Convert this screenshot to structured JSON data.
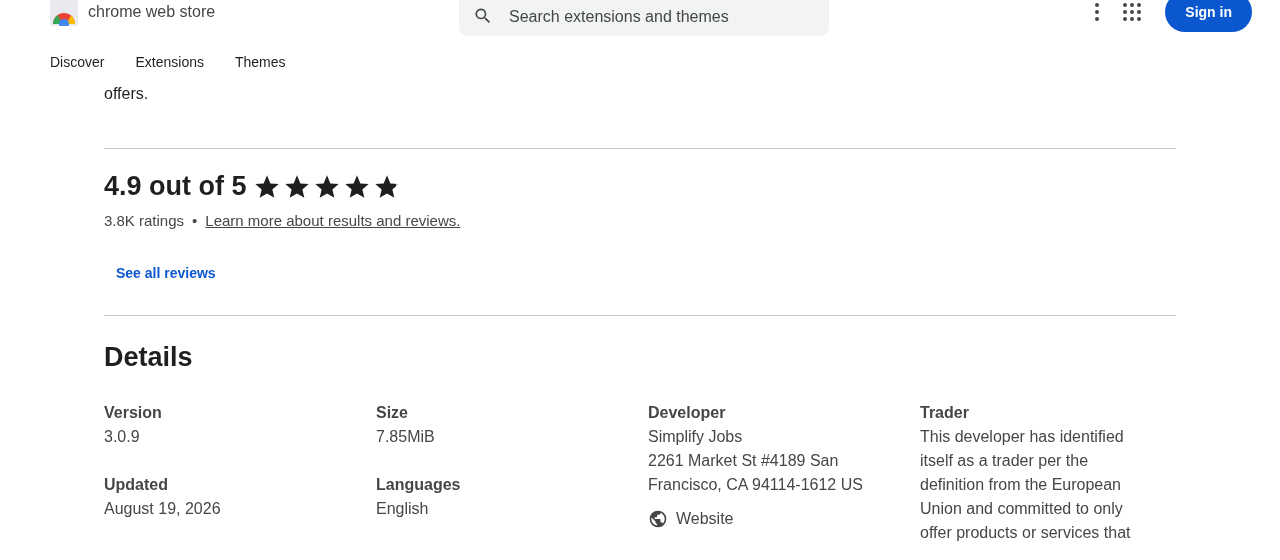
{
  "header": {
    "store_name": "chrome web store",
    "search": {
      "placeholder": "Search extensions and themes"
    },
    "sign_in": "Sign in"
  },
  "nav": [
    {
      "label": "Discover"
    },
    {
      "label": "Extensions"
    },
    {
      "label": "Themes"
    }
  ],
  "overview_tail": "offers.",
  "rating": {
    "score": "4.9 out of 5",
    "stars": 4.9,
    "count": "3.8K ratings",
    "separator": "•",
    "learn_more": "Learn more about results and reviews.",
    "see_all": "See all reviews"
  },
  "details": {
    "title": "Details",
    "columns": [
      {
        "items": [
          {
            "label": "Version",
            "lines": [
              "3.0.9"
            ]
          },
          {
            "label": "Updated",
            "lines": [
              "August 19, 2026"
            ]
          }
        ]
      },
      {
        "items": [
          {
            "label": "Size",
            "lines": [
              "7.85MiB"
            ]
          },
          {
            "label": "Languages",
            "lines": [
              "English"
            ]
          }
        ]
      },
      {
        "items": [
          {
            "label": "Developer",
            "lines": [
              "Simplify Jobs",
              "2261 Market St #4189 San Francisco, CA 94114-1612 US"
            ],
            "link": "Website"
          }
        ]
      },
      {
        "items": [
          {
            "label": "Trader",
            "lines": [
              "This developer has identified itself as a trader per the definition from the European Union and committed to only offer products or services that"
            ]
          }
        ]
      }
    ]
  }
}
